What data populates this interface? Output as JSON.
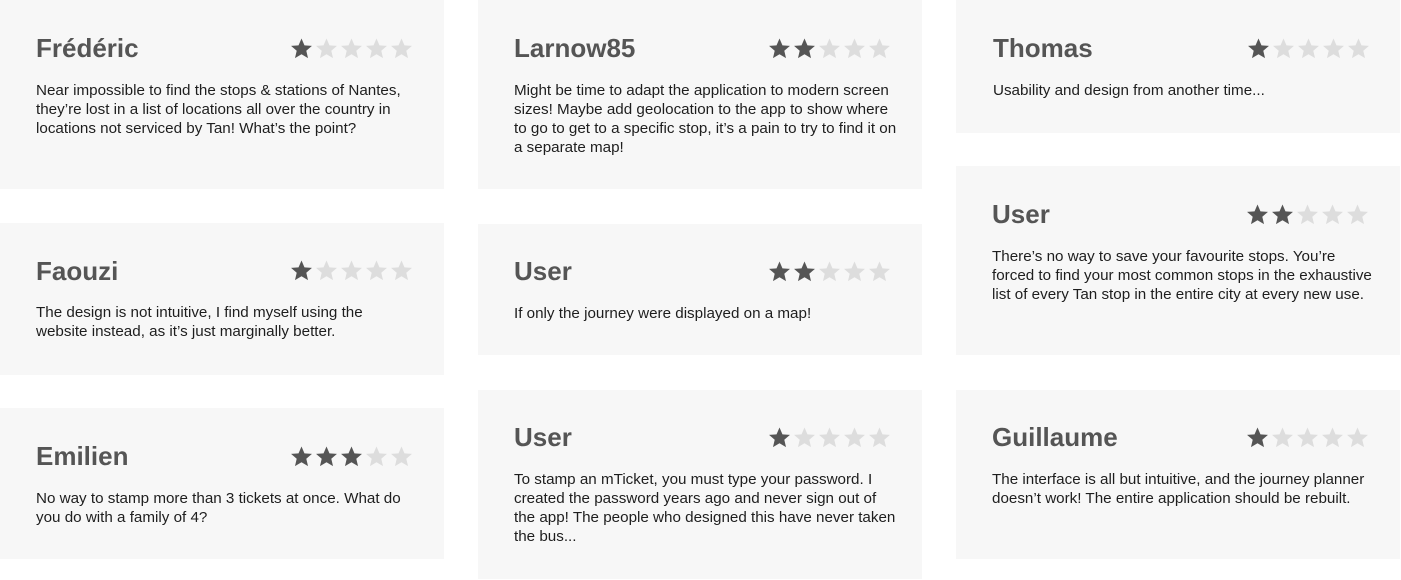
{
  "colors": {
    "star_filled": "#555555",
    "star_empty": "#dddddd",
    "card_bg": "#f7f7f7"
  },
  "reviews": [
    {
      "name": "Frédéric",
      "rating": 1,
      "text": "Near impossible to find the stops & stations of Nantes, they’re lost in a list of locations all over the country in locations not serviced by Tan! What’s the point?"
    },
    {
      "name": "Faouzi",
      "rating": 1,
      "text": "The design is not intuitive, I find myself using the website instead, as it’s just marginally better."
    },
    {
      "name": "Emilien",
      "rating": 3,
      "text": "No way to stamp more than 3 tickets at once. What do you do with a family of 4?"
    },
    {
      "name": "Larnow85",
      "rating": 2,
      "text": "Might be time to adapt the application to modern screen sizes! Maybe add geolocation to the app to show where to go to get to a specific stop, it’s a pain to try to find it on a separate map!"
    },
    {
      "name": "User",
      "rating": 2,
      "text": "If only the journey were displayed on a map!"
    },
    {
      "name": "User",
      "rating": 1,
      "text": "To stamp an mTicket, you must type your password. I created the password years ago and never sign out of the app! The people who designed this have never taken the bus..."
    },
    {
      "name": "Thomas",
      "rating": 1,
      "text": "Usability and design from another time..."
    },
    {
      "name": "User",
      "rating": 2,
      "text": "There’s no way to save your favourite stops. You’re forced to find your most common stops in the exhaustive list of every Tan stop in the entire city at every new use."
    },
    {
      "name": "Guillaume",
      "rating": 1,
      "text": "The interface is all but intuitive, and the journey planner doesn’t work! The entire application should be rebuilt."
    }
  ]
}
